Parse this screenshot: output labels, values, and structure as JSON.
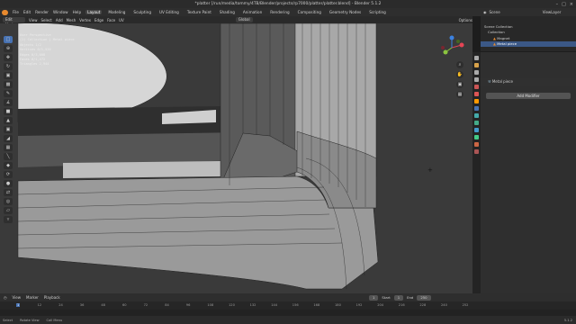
{
  "window": {
    "title": "*platter [/run/media/tommy/4TB/Blender/projects/rp7000/platter/platter.blend] - Blender 5.1.2"
  },
  "topbar": {
    "menus": [
      "File",
      "Edit",
      "Render",
      "Window",
      "Help"
    ],
    "workspaces": [
      "Layout",
      "Modeling",
      "Sculpting",
      "UV Editing",
      "Texture Paint",
      "Shading",
      "Animation",
      "Rendering",
      "Compositing",
      "Geometry Nodes",
      "Scripting"
    ],
    "active_workspace": "Layout"
  },
  "viewport": {
    "mode": "Edit Mode",
    "menus": [
      "View",
      "Select",
      "Add",
      "Mesh",
      "Vertex",
      "Edge",
      "Face",
      "UV"
    ],
    "orientation": "Global",
    "options_label": "Options",
    "stats": [
      [
        "User Perspective",
        ""
      ],
      [
        "(1) Collection | Metal piece",
        ""
      ],
      [
        "Objects",
        "1/2"
      ],
      [
        "Vertices",
        "0/1,536"
      ],
      [
        "Edges",
        "0/3,008"
      ],
      [
        "Faces",
        "0/1,472"
      ],
      [
        "Triangles",
        "2,944"
      ]
    ]
  },
  "outliner": {
    "header": {
      "scene": "Scene",
      "view_layer": "ViewLayer"
    },
    "rows": [
      {
        "label": "Scene Collection",
        "selected": false
      },
      {
        "label": "Collection",
        "selected": false
      },
      {
        "label": "Magnet",
        "selected": false
      },
      {
        "label": "Metal piece",
        "selected": true
      }
    ]
  },
  "properties": {
    "object_name": "Metal piece",
    "add_modifier": "Add Modifier"
  },
  "timeline": {
    "menus": [
      "View",
      "Marker",
      "Playback"
    ],
    "current_frame": "1",
    "start_label": "Start",
    "start": "1",
    "end_label": "End",
    "end": "250",
    "ticks": [
      "1",
      "12",
      "24",
      "36",
      "48",
      "60",
      "72",
      "84",
      "96",
      "108",
      "120",
      "132",
      "144",
      "156",
      "168",
      "180",
      "192",
      "204",
      "216",
      "228",
      "240",
      "252"
    ]
  },
  "statusbar": {
    "items": [
      "Select",
      "Rotate View",
      "Call Menu"
    ],
    "version": "5.1.2"
  },
  "colors": {
    "accent": "#4772b3",
    "selection": "#3b5886",
    "brand": "#e88a2e"
  }
}
